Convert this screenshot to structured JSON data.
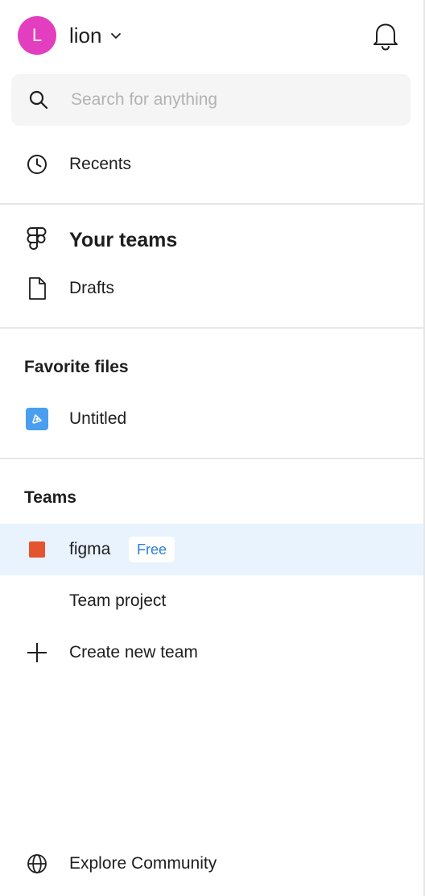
{
  "header": {
    "avatar_initial": "L",
    "avatar_color": "#e23ebf",
    "username": "lion",
    "chevron_icon": "chevron-down-icon",
    "notification_icon": "bell-icon"
  },
  "search": {
    "placeholder": "Search for anything",
    "value": "",
    "icon": "search-icon"
  },
  "nav": {
    "recents": {
      "label": "Recents",
      "icon": "clock-icon"
    },
    "your_teams": {
      "label": "Your teams",
      "icon": "figma-logo-icon"
    },
    "drafts": {
      "label": "Drafts",
      "icon": "document-icon"
    }
  },
  "favorites": {
    "title": "Favorite files",
    "items": [
      {
        "label": "Untitled",
        "icon": "design-file-icon"
      }
    ]
  },
  "teams": {
    "title": "Teams",
    "items": [
      {
        "label": "figma",
        "badge": "Free",
        "color": "#e4542f",
        "selected": true
      }
    ],
    "team_project_label": "Team project",
    "create_label": "Create new team",
    "create_icon": "plus-icon"
  },
  "footer": {
    "explore_label": "Explore Community",
    "explore_icon": "globe-icon"
  },
  "colors": {
    "selected_row": "#e8f3fd",
    "badge_text": "#2b7fd8",
    "file_icon": "#4a9ef0"
  }
}
